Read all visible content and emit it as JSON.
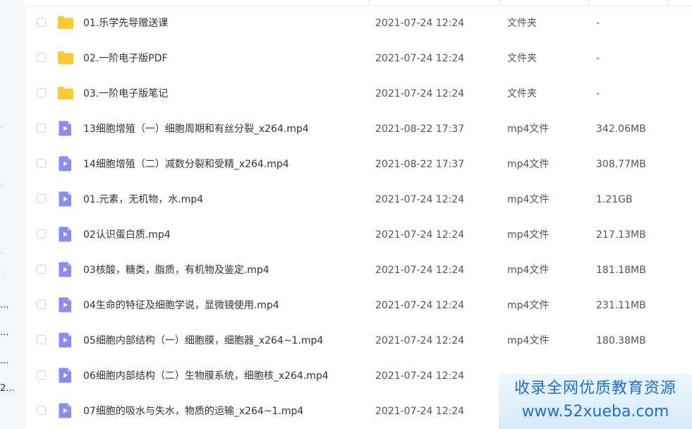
{
  "sidebar": {
    "truncated_labels": [
      "...",
      "...",
      "...",
      "2..."
    ]
  },
  "files": [
    {
      "name": "01.乐学先导赠送课",
      "date": "2021-07-24 12:24",
      "type": "文件夹",
      "size": "-",
      "kind": "folder"
    },
    {
      "name": "02.一阶电子版PDF",
      "date": "2021-07-24 12:24",
      "type": "文件夹",
      "size": "-",
      "kind": "folder"
    },
    {
      "name": "03.一阶电子版笔记",
      "date": "2021-07-24 12:24",
      "type": "文件夹",
      "size": "-",
      "kind": "folder"
    },
    {
      "name": "13细胞增殖（一）细胞周期和有丝分裂_x264.mp4",
      "date": "2021-08-22 17:37",
      "type": "mp4文件",
      "size": "342.06MB",
      "kind": "video"
    },
    {
      "name": "14细胞增殖（二）减数分裂和受精_x264.mp4",
      "date": "2021-08-22 17:37",
      "type": "mp4文件",
      "size": "308.77MB",
      "kind": "video"
    },
    {
      "name": "01.元素，无机物，水.mp4",
      "date": "2021-07-24 12:24",
      "type": "mp4文件",
      "size": "1.21GB",
      "kind": "video"
    },
    {
      "name": "02认识蛋白质.mp4",
      "date": "2021-07-24 12:24",
      "type": "mp4文件",
      "size": "217.13MB",
      "kind": "video"
    },
    {
      "name": "03核酸，糖类，脂质，有机物及鉴定.mp4",
      "date": "2021-07-24 12:24",
      "type": "mp4文件",
      "size": "181.18MB",
      "kind": "video"
    },
    {
      "name": "04生命的特征及细胞学说，显微镜使用.mp4",
      "date": "2021-07-24 12:24",
      "type": "mp4文件",
      "size": "231.11MB",
      "kind": "video"
    },
    {
      "name": "05细胞内部结构（一）细胞膜，细胞器_x264~1.mp4",
      "date": "2021-07-24 12:24",
      "type": "mp4文件",
      "size": "180.38MB",
      "kind": "video"
    },
    {
      "name": "06细胞内部结构（二）生物膜系统，细胞核_x264.mp4",
      "date": "2021-07-24 12:24",
      "type": "",
      "size": "",
      "kind": "video"
    },
    {
      "name": "07细胞的吸水与失水，物质的运输_x264~1.mp4",
      "date": "2021-07-24 12:24",
      "type": "",
      "size": "",
      "kind": "video"
    }
  ],
  "icons": {
    "folder": "folder-icon",
    "video": "video-file-icon"
  },
  "colors": {
    "folder": "#FFC830",
    "video": "#8A8CF5",
    "watermark_text": "#1a6fd6"
  },
  "watermark": {
    "line1": "收录全网优质教育资源",
    "line2": "www.52xueba.com"
  }
}
